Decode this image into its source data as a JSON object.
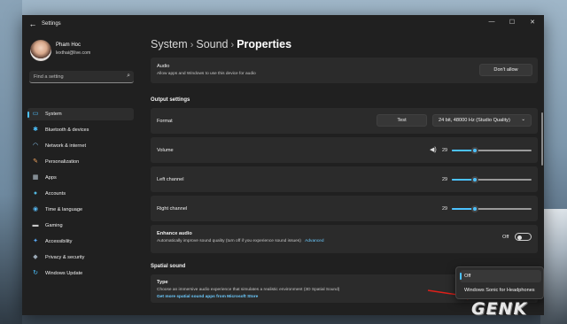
{
  "window": {
    "title": "Settings",
    "back_glyph": "←",
    "controls": {
      "minimize": "—",
      "maximize": "☐",
      "close": "✕"
    }
  },
  "user": {
    "name": "Pham Hoc",
    "email": "lexthai@live.com"
  },
  "search": {
    "placeholder": "Find a setting",
    "icon": "search-icon"
  },
  "sidebar": {
    "items": [
      {
        "label": "System",
        "icon": "monitor-icon",
        "glyph": "▭",
        "color": "#4cc2ff",
        "active": true
      },
      {
        "label": "Bluetooth & devices",
        "icon": "bluetooth-icon",
        "glyph": "✱",
        "color": "#4cc2ff"
      },
      {
        "label": "Network & internet",
        "icon": "wifi-icon",
        "glyph": "◠",
        "color": "#8fd0ff"
      },
      {
        "label": "Personalization",
        "icon": "brush-icon",
        "glyph": "✎",
        "color": "#f0a35e"
      },
      {
        "label": "Apps",
        "icon": "apps-icon",
        "glyph": "▦",
        "color": "#b9c6d2"
      },
      {
        "label": "Accounts",
        "icon": "person-icon",
        "glyph": "●",
        "color": "#52b8e0"
      },
      {
        "label": "Time & language",
        "icon": "globe-clock-icon",
        "glyph": "◉",
        "color": "#56b6f0"
      },
      {
        "label": "Gaming",
        "icon": "gamepad-icon",
        "glyph": "▬",
        "color": "#c9c9c9"
      },
      {
        "label": "Accessibility",
        "icon": "accessibility-icon",
        "glyph": "✦",
        "color": "#5aa9f5"
      },
      {
        "label": "Privacy & security",
        "icon": "shield-icon",
        "glyph": "◆",
        "color": "#9aa8b5"
      },
      {
        "label": "Windows Update",
        "icon": "update-icon",
        "glyph": "↻",
        "color": "#4cc2ff"
      }
    ]
  },
  "breadcrumb": {
    "part1": "System",
    "part2": "Sound",
    "current": "Properties",
    "separator": "›"
  },
  "audio": {
    "title": "Audio",
    "description": "Allow apps and Windows to use this device for audio",
    "button": "Don't allow"
  },
  "output_settings": {
    "heading": "Output settings",
    "format": {
      "label": "Format",
      "test_button": "Test",
      "value": "24 bit, 48000 Hz (Studio Quality)",
      "chevron": "⌄"
    },
    "volume": {
      "label": "Volume",
      "value": "29",
      "level": 0.29,
      "icon": "speaker-icon"
    },
    "left_channel": {
      "label": "Left channel",
      "value": "29",
      "level": 0.29
    },
    "right_channel": {
      "label": "Right channel",
      "value": "29",
      "level": 0.29
    },
    "enhance": {
      "title": "Enhance audio",
      "description": "Automatically improve sound quality (turn off if you experience sound issues)",
      "link": "Advanced",
      "state": "Off"
    }
  },
  "spatial_sound": {
    "heading": "Spatial sound",
    "type_title": "Type",
    "type_description": "Choose an immersive audio experience that simulates a realistic environment (3D Spatial Sound)",
    "store_link": "Get more spatial sound apps from Microsoft Store",
    "options": [
      "Off",
      "Windows Sonic for Headphones"
    ],
    "selected": "Off"
  },
  "colors": {
    "accent": "#4cc2ff",
    "window_bg": "#202020",
    "card_bg": "#2b2b2b",
    "arrow": "#e0201a"
  },
  "watermark": {
    "text": "GENK"
  }
}
